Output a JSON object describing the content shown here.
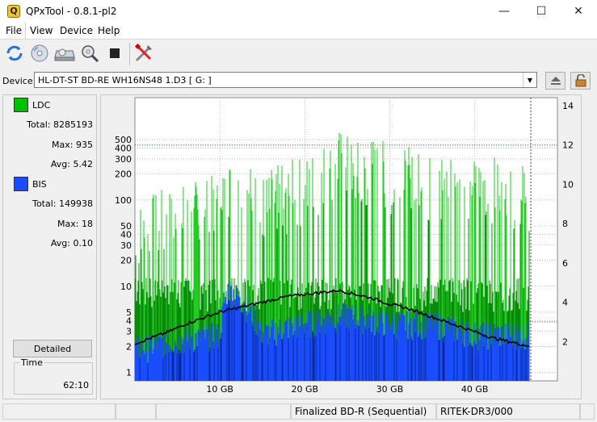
{
  "window": {
    "title": "QPxTool - 0.8.1-pl2",
    "app_icon_letter": "Q",
    "minimize_glyph": "—",
    "maximize_glyph": "☐",
    "close_glyph": "✕"
  },
  "menu": [
    "File",
    "View",
    "Device",
    "Help"
  ],
  "toolbar": {
    "icons": [
      "refresh-icon",
      "disc-icon",
      "drive-icon",
      "zoom-disc-icon",
      "stop-icon",
      "settings-tools-icon"
    ]
  },
  "device": {
    "label": "Device:",
    "value": "HL-DT-ST BD-RE  WH16NS48  1.D3 [ G: ]"
  },
  "stats": {
    "ldc": {
      "label": "LDC",
      "color": "#00c000",
      "total_label": "Total:",
      "total": "8285193",
      "max_label": "Max:",
      "max": "935",
      "avg_label": "Avg:",
      "avg": "5.42"
    },
    "bis": {
      "label": "BIS",
      "color": "#1a4dff",
      "total_label": "Total:",
      "total": "149938",
      "max_label": "Max:",
      "max": "18",
      "avg_label": "Avg:",
      "avg": "0.10"
    }
  },
  "detailed_button": "Detailed",
  "time": {
    "label": "Time",
    "value": "62:10"
  },
  "status": {
    "cells": [
      "",
      "",
      "",
      "Finalized BD-R (Sequential)",
      "RITEK-DR3/000",
      ""
    ]
  },
  "chart_data": {
    "type": "area",
    "x_unit": "GB",
    "xlim": [
      0,
      46.5
    ],
    "x_ticks": [
      "10 GB",
      "20 GB",
      "30 GB",
      "40 GB"
    ],
    "x_tick_values": [
      10,
      20,
      30,
      40
    ],
    "y_left_scale": "log",
    "ylim_left": [
      0.8,
      1000
    ],
    "y_left_ticks": [
      1,
      2,
      3,
      4,
      5,
      10,
      20,
      30,
      40,
      50,
      100,
      200,
      300,
      400,
      500
    ],
    "ylim_right": [
      0,
      14
    ],
    "y_right_ticks": [
      2,
      4,
      6,
      8,
      10,
      12,
      14
    ],
    "red_reference_lines_right": [
      12,
      3
    ],
    "grid": true,
    "series": [
      {
        "name": "LDC",
        "color": "#00c000",
        "peak_envelope_x": [
          0,
          5,
          10,
          11,
          15,
          18,
          20,
          22,
          24,
          26,
          28,
          30,
          33,
          35,
          37,
          40,
          42,
          44,
          46
        ],
        "peak_envelope_y": [
          100,
          150,
          200,
          380,
          220,
          280,
          350,
          500,
          700,
          500,
          600,
          450,
          400,
          350,
          450,
          300,
          350,
          200,
          300
        ]
      },
      {
        "name": "BIS",
        "color": "#1a4dff",
        "x": [
          0,
          5,
          10,
          11,
          15,
          20,
          25,
          30,
          35,
          40,
          46
        ],
        "y": [
          2,
          2.5,
          3,
          10,
          3,
          4,
          5,
          4,
          4,
          3,
          3
        ]
      },
      {
        "name": "Speed",
        "color": "#000000",
        "x": [
          0,
          2,
          4,
          6,
          8,
          10,
          12,
          14,
          16,
          18,
          20,
          22,
          24,
          26,
          28,
          30,
          32,
          34,
          36,
          38,
          40,
          42,
          44,
          46
        ],
        "y": [
          1.9,
          2.2,
          2.5,
          2.9,
          3.2,
          3.5,
          3.7,
          3.9,
          4.1,
          4.3,
          4.4,
          4.5,
          4.6,
          4.4,
          4.2,
          3.9,
          3.7,
          3.4,
          3.1,
          2.8,
          2.5,
          2.2,
          2.0,
          1.8
        ]
      }
    ]
  }
}
